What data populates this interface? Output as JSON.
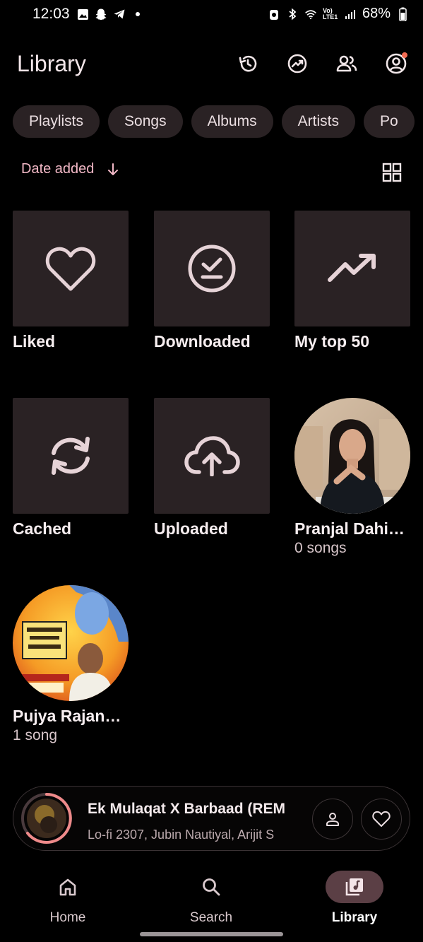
{
  "status_bar": {
    "time": "12:03",
    "battery": "68%",
    "network": "Vo) LTE1"
  },
  "header": {
    "title": "Library"
  },
  "chips": [
    "Playlists",
    "Songs",
    "Albums",
    "Artists",
    "Po"
  ],
  "sort": {
    "label": "Date added"
  },
  "items": [
    {
      "title": "Liked",
      "icon": "heart-icon"
    },
    {
      "title": "Downloaded",
      "icon": "download-done-icon"
    },
    {
      "title": "My top 50",
      "icon": "trending-up-icon"
    },
    {
      "title": "Cached",
      "icon": "sync-icon"
    },
    {
      "title": "Uploaded",
      "icon": "cloud-upload-icon"
    },
    {
      "title": "Pranjal Dahi…",
      "subtitle": "0 songs",
      "icon": "artist-avatar"
    },
    {
      "title": "Pujya Rajan…",
      "subtitle": "1 song",
      "icon": "artist-avatar"
    }
  ],
  "mini_player": {
    "title": "Ek Mulaqat X Barbaad (REM",
    "artist": "Lo-fi 2307, Jubin Nautiyal, Arijit S"
  },
  "nav": {
    "home": "Home",
    "search": "Search",
    "library": "Library"
  },
  "colors": {
    "accent": "#f2b8c6",
    "tile_bg": "#2a2224",
    "nav_active_pill": "#5b3f45",
    "notification_dot": "#f26b52"
  }
}
